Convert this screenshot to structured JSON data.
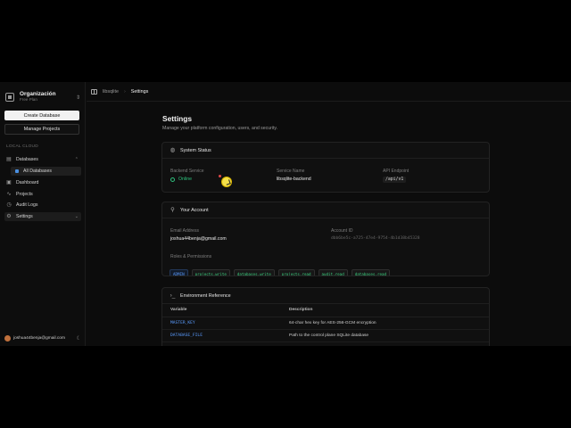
{
  "sidebar": {
    "org_name": "Organización",
    "org_plan": "Free Plan",
    "create_button": "Create Database",
    "manage_button": "Manage Projects",
    "section_label": "LOCAL CLOUD",
    "items": [
      {
        "label": "Databases",
        "icon": "database-icon"
      },
      {
        "label": "All Databases",
        "icon": "dot-icon"
      },
      {
        "label": "Dashboard",
        "icon": "dashboard-icon"
      },
      {
        "label": "Projects",
        "icon": "activity-icon"
      },
      {
        "label": "Audit Logs",
        "icon": "clock-icon"
      },
      {
        "label": "Settings",
        "icon": "gear-icon"
      }
    ],
    "user_email": "joshua44benja@gmail.com"
  },
  "topbar": {
    "crumb_1": "libsqlite",
    "crumb_2": "Settings"
  },
  "page": {
    "title": "Settings",
    "subtitle": "Manage your platform configuration, users, and security."
  },
  "system_status": {
    "title": "System Status",
    "backend_label": "Backend Service",
    "backend_value": "Online",
    "service_label": "Service Name",
    "service_value": "libsqlite-backend",
    "api_label": "API Endpoint",
    "api_value": "/api/v1"
  },
  "account": {
    "title": "Your Account",
    "email_label": "Email Address",
    "email_value": "joshua44benja@gmail.com",
    "id_label": "Account ID",
    "id_value": "dbb6be5c-a725-47e4-9754-4b1d38b45328",
    "roles_label": "Roles & Permissions",
    "roles": [
      "ADMIN",
      "projects.write",
      "databases.write",
      "projects.read",
      "audit.read",
      "databases.read"
    ]
  },
  "env": {
    "title": "Environment Reference",
    "col_variable": "Variable",
    "col_description": "Description",
    "rows": [
      {
        "variable": "MASTER_KEY",
        "description": "64-char hex key for AES-256-GCM encryption"
      },
      {
        "variable": "DATABASE_FILE",
        "description": "Path to the control plane SQLite database"
      }
    ]
  },
  "colors": {
    "accent_blue": "#5b9cff",
    "online_green": "#2ec27e"
  }
}
